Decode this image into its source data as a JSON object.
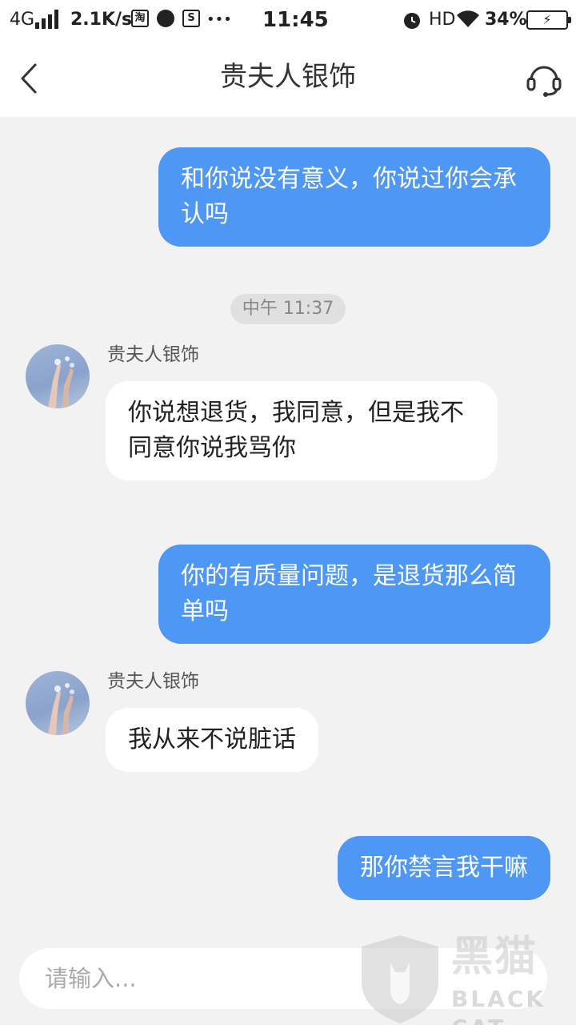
{
  "status_bar": {
    "network": "4G",
    "speed": "2.1K/s",
    "taobao_glyph": "淘",
    "s_glyph": "S",
    "more": "•••",
    "time": "11:45",
    "hd": "HD",
    "battery": "34%",
    "icons": [
      "signal-icon",
      "taobao-icon",
      "app-icon",
      "s-icon",
      "alarm-icon",
      "wifi-icon",
      "battery-icon"
    ]
  },
  "header": {
    "title": "贵夫人银饰",
    "icons": [
      "back-icon",
      "customer-service-icon"
    ]
  },
  "messages": {
    "out1": "和你说没有意义，你说过你会承认吗",
    "time_divider": "中午 11:37",
    "in1_sender": "贵夫人银饰",
    "in1": "你说想退货，我同意，但是我不同意你说我骂你",
    "out2": "你的有质量问题，是退货那么简单吗",
    "in2_sender": "贵夫人银饰",
    "in2": "我从来不说脏话",
    "out3": "那你禁言我干嘛"
  },
  "input": {
    "placeholder": "请输入..."
  },
  "watermark": {
    "cn": "黑猫",
    "en": "BLACK CAT"
  },
  "colors": {
    "outgoing_bubble": "#4f97f4",
    "incoming_bubble": "#ffffff",
    "background": "#f2f2f2",
    "header": "#ffffff"
  }
}
